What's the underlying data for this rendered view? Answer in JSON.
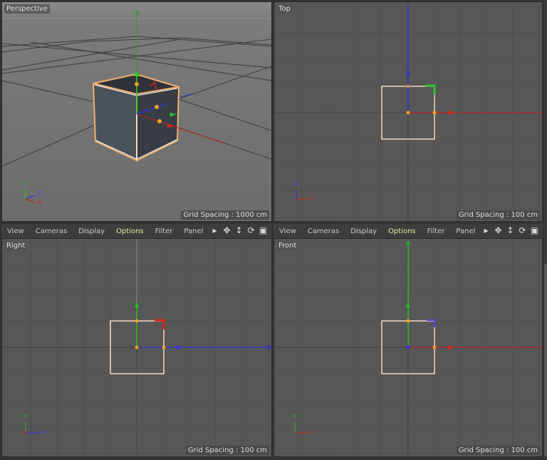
{
  "viewports": {
    "perspective": {
      "label": "Perspective",
      "grid_spacing": "Grid Spacing : 1000 cm"
    },
    "top": {
      "label": "Top",
      "grid_spacing": "Grid Spacing : 100 cm"
    },
    "right": {
      "label": "Right",
      "grid_spacing": "Grid Spacing : 100 cm"
    },
    "front": {
      "label": "Front",
      "grid_spacing": "Grid Spacing : 100 cm"
    }
  },
  "menu": {
    "items": [
      "View",
      "Cameras",
      "Display",
      "Options",
      "Filter",
      "Panel"
    ],
    "active": "Options"
  },
  "axis_labels": {
    "x": "X",
    "y": "Y",
    "z": "Z"
  },
  "tool_icons": [
    "expand-arrow-icon",
    "move-icon",
    "zoom-icon",
    "rotate-icon",
    "maximize-icon"
  ],
  "colors": {
    "x_axis": "#d62828",
    "y_axis": "#22b022",
    "z_axis": "#3a3ae0",
    "selection": "#f0b070",
    "active_menu": "#e6e6a0"
  }
}
